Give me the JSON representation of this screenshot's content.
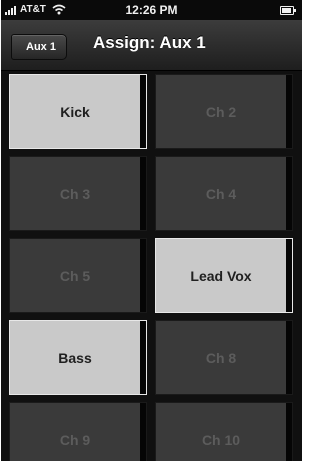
{
  "status_bar": {
    "carrier": "AT&T",
    "time": "12:26 PM"
  },
  "nav": {
    "back_label": "Aux 1",
    "title": "Assign: Aux 1"
  },
  "channels": [
    {
      "label": "Kick",
      "assigned": true
    },
    {
      "label": "Ch 2",
      "assigned": false
    },
    {
      "label": "Ch 3",
      "assigned": false
    },
    {
      "label": "Ch 4",
      "assigned": false
    },
    {
      "label": "Ch 5",
      "assigned": false
    },
    {
      "label": "Lead Vox",
      "assigned": true
    },
    {
      "label": "Bass",
      "assigned": true
    },
    {
      "label": "Ch 8",
      "assigned": false
    },
    {
      "label": "Ch 9",
      "assigned": false
    },
    {
      "label": "Ch 10",
      "assigned": false
    }
  ],
  "colors": {
    "assigned": "#c9c9c9",
    "unassigned": "#3a3a3a",
    "nav_bar": "#2a2a2a"
  }
}
